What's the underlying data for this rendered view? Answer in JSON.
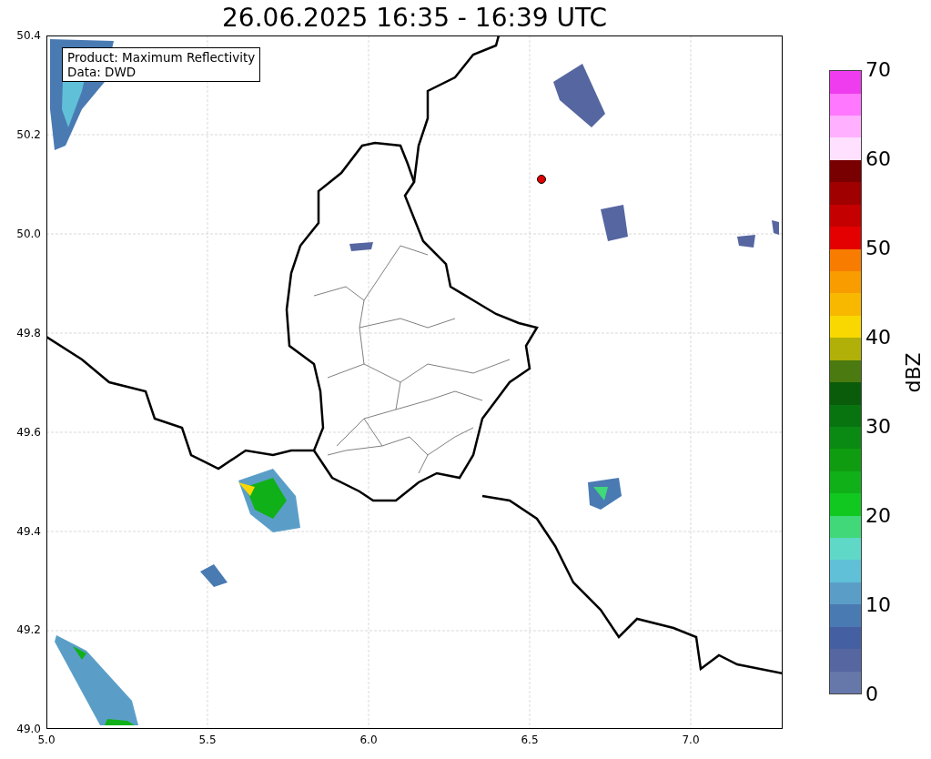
{
  "title": "26.06.2025 16:35 - 16:39 UTC",
  "info_box": [
    "Product: Maximum Reflectivity",
    "Data: DWD"
  ],
  "map": {
    "xticks": [
      "5.0",
      "5.5",
      "6.0",
      "6.5",
      "7.0"
    ],
    "yticks": [
      "50.4",
      "50.2",
      "50.0",
      "49.8",
      "49.6",
      "49.4",
      "49.2",
      "49.0"
    ]
  },
  "colorbar": {
    "label": "dBZ",
    "ticks": [
      "70",
      "60",
      "50",
      "40",
      "30",
      "20",
      "10",
      "0"
    ],
    "segments": [
      {
        "color": "#6677aa"
      },
      {
        "color": "#5566a0"
      },
      {
        "color": "#4560a2"
      },
      {
        "color": "#4a7ab2"
      },
      {
        "color": "#5a9ec8"
      },
      {
        "color": "#60c0d8"
      },
      {
        "color": "#60d8c8"
      },
      {
        "color": "#40d878"
      },
      {
        "color": "#10c820"
      },
      {
        "color": "#10b018"
      },
      {
        "color": "#109c10"
      },
      {
        "color": "#0a8a12"
      },
      {
        "color": "#087410"
      },
      {
        "color": "#0a5c0a"
      },
      {
        "color": "#4a7a10"
      },
      {
        "color": "#b0b008"
      },
      {
        "color": "#f8d800"
      },
      {
        "color": "#f8b800"
      },
      {
        "color": "#f89c00"
      },
      {
        "color": "#f87c00"
      },
      {
        "color": "#e40000"
      },
      {
        "color": "#c40000"
      },
      {
        "color": "#a00000"
      },
      {
        "color": "#780000"
      },
      {
        "color": "#ffe0ff"
      },
      {
        "color": "#ffb0ff"
      },
      {
        "color": "#ff78ff"
      },
      {
        "color": "#ee3cee"
      }
    ]
  }
}
